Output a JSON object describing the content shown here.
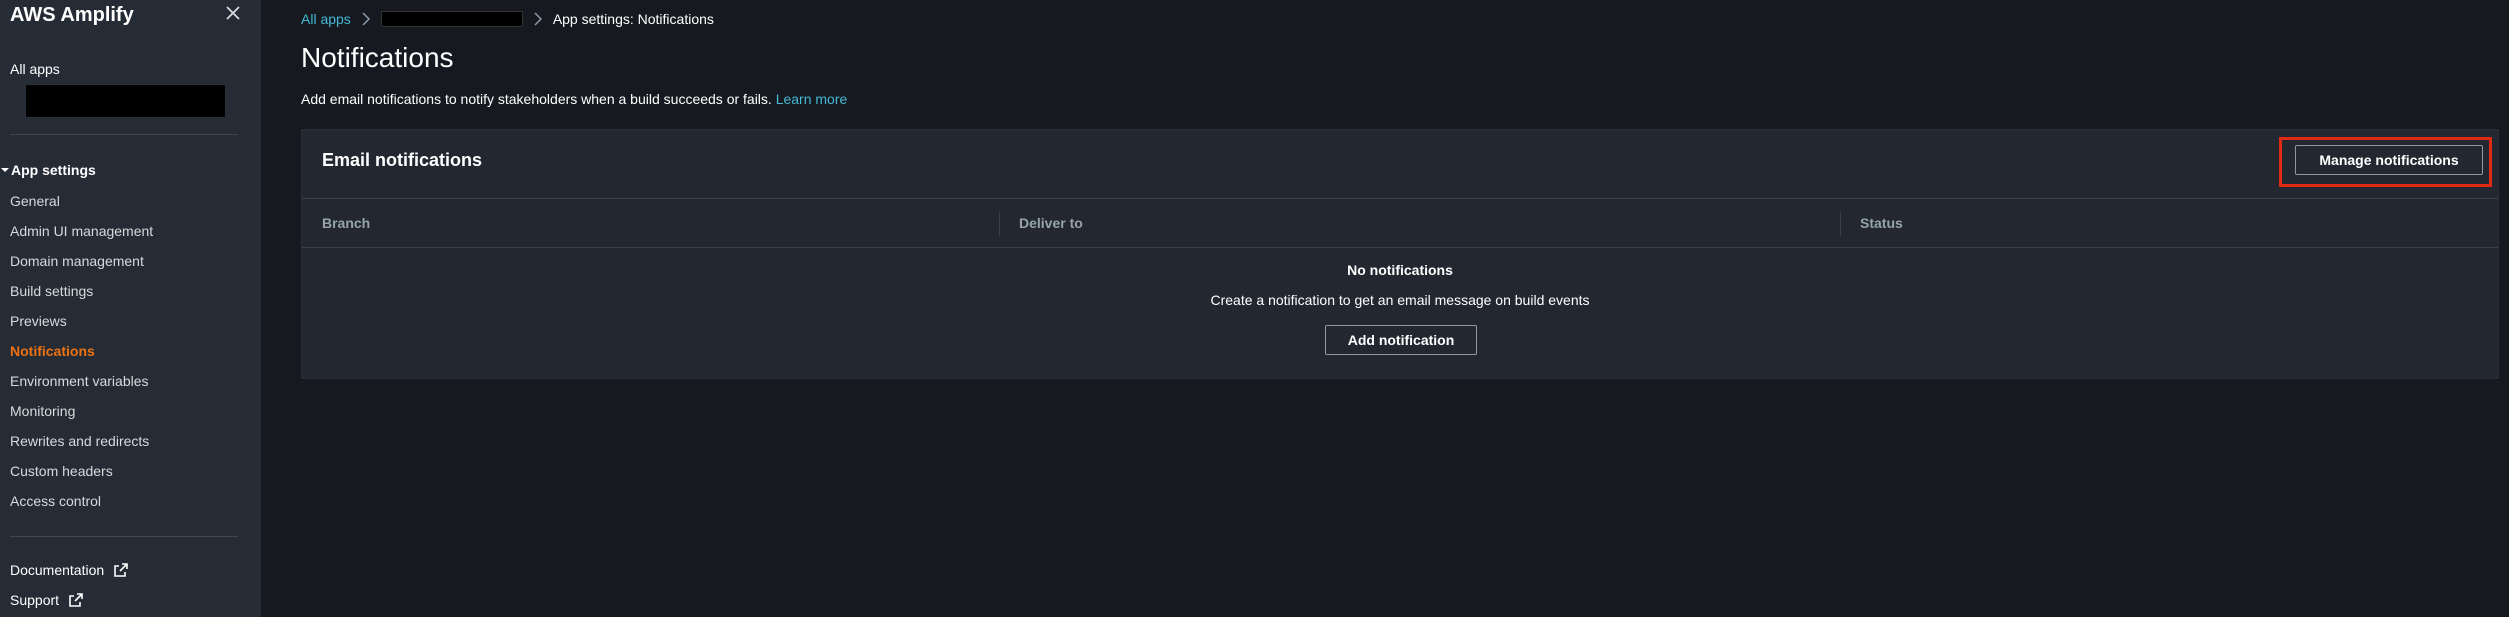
{
  "sidebar": {
    "title": "AWS Amplify",
    "all_apps": "All apps",
    "section": "App settings",
    "items": [
      {
        "label": "General"
      },
      {
        "label": "Admin UI management"
      },
      {
        "label": "Domain management"
      },
      {
        "label": "Build settings"
      },
      {
        "label": "Previews"
      },
      {
        "label": "Notifications"
      },
      {
        "label": "Environment variables"
      },
      {
        "label": "Monitoring"
      },
      {
        "label": "Rewrites and redirects"
      },
      {
        "label": "Custom headers"
      },
      {
        "label": "Access control"
      }
    ],
    "active_item": "Notifications",
    "external_links": [
      {
        "label": "Documentation"
      },
      {
        "label": "Support"
      }
    ]
  },
  "breadcrumb": {
    "root": "All apps",
    "current": "App settings: Notifications"
  },
  "page": {
    "title": "Notifications",
    "description": "Add email notifications to notify stakeholders when a build succeeds or fails.",
    "learn_more": "Learn more"
  },
  "panel": {
    "title": "Email notifications",
    "manage_button": "Manage notifications",
    "columns": [
      "Branch",
      "Deliver to",
      "Status"
    ],
    "empty_title": "No notifications",
    "empty_description": "Create a notification to get an email message on build events",
    "add_button": "Add notification"
  },
  "colors": {
    "accent_link": "#44b9d6",
    "active_nav": "#ec7211",
    "highlight_box": "#e22a13",
    "background": "#16191f"
  }
}
